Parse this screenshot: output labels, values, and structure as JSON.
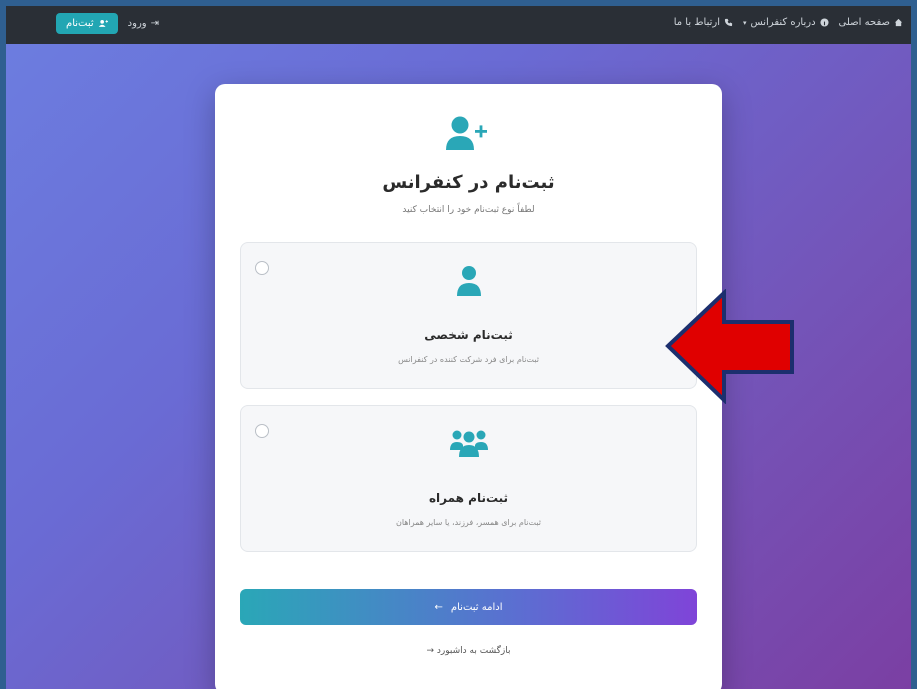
{
  "navbar": {
    "items": [
      {
        "label": "صفحه اصلی",
        "icon": "home-icon"
      },
      {
        "label": "درباره کنفرانس",
        "icon": "info-icon",
        "dropdown": true
      },
      {
        "label": "ارتباط با ما",
        "icon": "phone-icon"
      }
    ],
    "register_label": "ثبت‌نام",
    "login_label": "ورود"
  },
  "card": {
    "title": "ثبت‌نام در کنفرانس",
    "subtitle": "لطفاً نوع ثبت‌نام خود را انتخاب کنید",
    "options": [
      {
        "title": "ثبت‌نام شخصی",
        "description": "ثبت‌نام برای فرد شرکت کننده در کنفرانس",
        "icon": "user-icon",
        "selected": false
      },
      {
        "title": "ثبت‌نام همراه",
        "description": "ثبت‌نام برای همسر، فرزند، یا سایر همراهان",
        "icon": "users-group-icon",
        "selected": false
      }
    ],
    "continue_label": "ادامه ثبت‌نام",
    "back_label": "بازگشت به داشبورد"
  },
  "colors": {
    "accent": "#2aa7b7",
    "gradient_end": "#7f44d8",
    "annotation_arrow": "#e00000",
    "annotation_outline": "#1c2f6e"
  }
}
